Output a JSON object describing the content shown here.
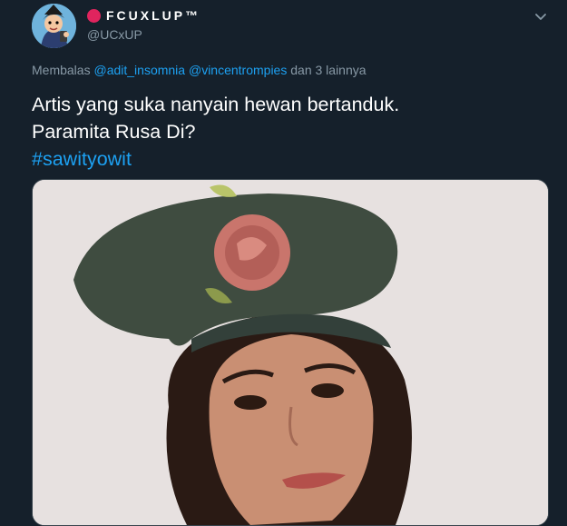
{
  "author": {
    "display_name": "FCUXLUP™",
    "handle": "@UCxUP",
    "avatar_icon": "cartoon-avatar",
    "badge_icon": "red-circle-icon"
  },
  "menu_icon": "chevron-down-icon",
  "reply": {
    "prefix": "Membalas",
    "mentions": [
      "@adit_insomnia",
      "@vincentrompies"
    ],
    "suffix": "dan 3 lainnya"
  },
  "tweet": {
    "line1": "Artis yang suka nanyain hewan bertanduk.",
    "line2": "Paramita Rusa Di?",
    "hashtag": "#sawityowit"
  },
  "media": {
    "type": "photo"
  },
  "colors": {
    "background": "#15202b",
    "accent": "#1da1f2",
    "secondary_text": "#8899a6",
    "badge": "#e0245e"
  }
}
